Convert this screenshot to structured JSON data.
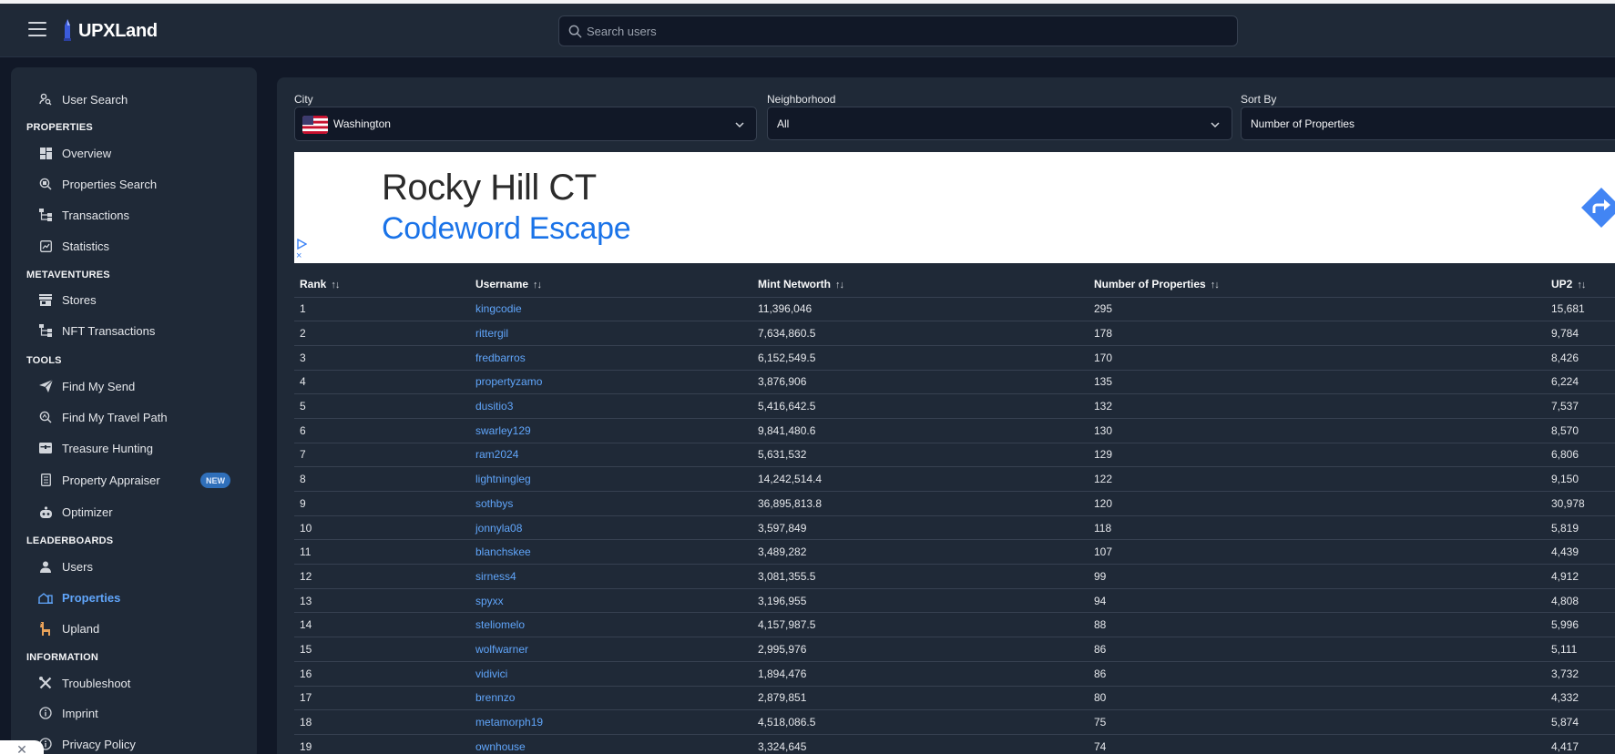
{
  "app": {
    "title": "UPXLand"
  },
  "search": {
    "placeholder": "Search users"
  },
  "sidebar": {
    "user_search": "User Search",
    "sections": {
      "properties": "PROPERTIES",
      "metaventures": "METAVENTURES",
      "tools": "TOOLS",
      "leaderboards": "LEADERBOARDS",
      "information": "INFORMATION"
    },
    "items": {
      "overview": "Overview",
      "properties_search": "Properties Search",
      "transactions": "Transactions",
      "statistics": "Statistics",
      "stores": "Stores",
      "nft_transactions": "NFT Transactions",
      "find_my_send": "Find My Send",
      "find_my_travel_path": "Find My Travel Path",
      "treasure_hunting": "Treasure Hunting",
      "property_appraiser": "Property Appraiser",
      "optimizer": "Optimizer",
      "users": "Users",
      "properties": "Properties",
      "upland": "Upland",
      "troubleshoot": "Troubleshoot",
      "imprint": "Imprint",
      "privacy_policy": "Privacy Policy"
    },
    "badge_new": "NEW",
    "active_item": "Properties"
  },
  "filters": {
    "city": {
      "label": "City",
      "value": "Washington"
    },
    "neighborhood": {
      "label": "Neighborhood",
      "value": "All"
    },
    "sort_by": {
      "label": "Sort By",
      "value": "Number of Properties"
    }
  },
  "ad": {
    "title": "Rocky Hill CT",
    "subtitle": "Codeword Escape",
    "close": "×"
  },
  "table": {
    "headers": {
      "rank": "Rank",
      "username": "Username",
      "mint_networth": "Mint Networth",
      "num_properties": "Number of Properties",
      "up2": "UP2"
    },
    "sort_glyph": "↑↓",
    "rows": [
      [
        "1",
        "kingcodie",
        "11,396,046",
        "295",
        "15,681"
      ],
      [
        "2",
        "rittergil",
        "7,634,860.5",
        "178",
        "9,784"
      ],
      [
        "3",
        "fredbarros",
        "6,152,549.5",
        "170",
        "8,426"
      ],
      [
        "4",
        "propertyzamo",
        "3,876,906",
        "135",
        "6,224"
      ],
      [
        "5",
        "dusitio3",
        "5,416,642.5",
        "132",
        "7,537"
      ],
      [
        "6",
        "swarley129",
        "9,841,480.6",
        "130",
        "8,570"
      ],
      [
        "7",
        "ram2024",
        "5,631,532",
        "129",
        "6,806"
      ],
      [
        "8",
        "lightningleg",
        "14,242,514.4",
        "122",
        "9,150"
      ],
      [
        "9",
        "sothbys",
        "36,895,813.8",
        "120",
        "30,978"
      ],
      [
        "10",
        "jonnyla08",
        "3,597,849",
        "118",
        "5,819"
      ],
      [
        "11",
        "blanchskee",
        "3,489,282",
        "107",
        "4,439"
      ],
      [
        "12",
        "sirness4",
        "3,081,355.5",
        "99",
        "4,912"
      ],
      [
        "13",
        "spyxx",
        "3,196,955",
        "94",
        "4,808"
      ],
      [
        "14",
        "steliomelo",
        "4,157,987.5",
        "88",
        "5,996"
      ],
      [
        "15",
        "wolfwarner",
        "2,995,976",
        "86",
        "5,111"
      ],
      [
        "16",
        "vidivici",
        "1,894,476",
        "86",
        "3,732"
      ],
      [
        "17",
        "brennzo",
        "2,879,851",
        "80",
        "4,332"
      ],
      [
        "18",
        "metamorph19",
        "4,518,086.5",
        "75",
        "5,874"
      ],
      [
        "19",
        "ownhouse",
        "3,324,645",
        "74",
        "4,417"
      ]
    ]
  },
  "colors": {
    "background": "#111827",
    "panel": "#1f2937",
    "link": "#60a5fa",
    "badge": "#2f6fba"
  },
  "icons": {
    "menu": "hamburger-menu-icon",
    "logo": "upx-tower-logo-icon",
    "search": "search-icon"
  }
}
